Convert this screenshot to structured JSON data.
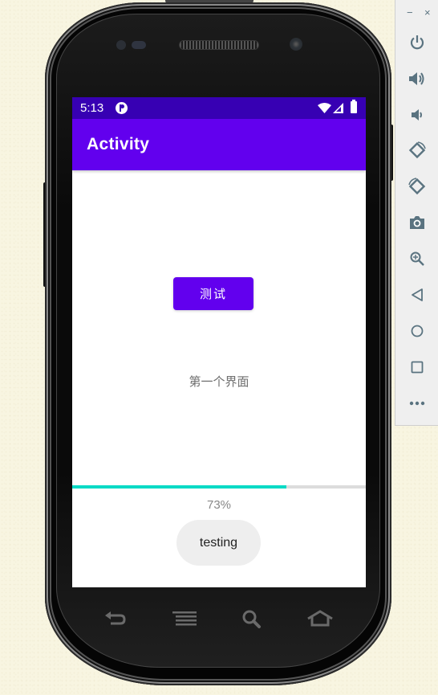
{
  "status_bar": {
    "time": "5:13",
    "app_icon": "notification-app-icon",
    "icons": [
      "wifi-icon",
      "signal-icon",
      "battery-icon"
    ]
  },
  "app_bar": {
    "title": "Activity"
  },
  "main": {
    "test_button_label": "测试",
    "page_label": "第一个界面",
    "progress": {
      "percent": 73,
      "text": "73%"
    },
    "toast_text": "testing"
  },
  "colors": {
    "status_bar": "#3700b3",
    "primary": "#6200ee",
    "progress_accent": "#03dac5",
    "progress_track": "#dcdcdc",
    "toast_bg": "#eeeeee",
    "toolbar_icon": "#5a7380"
  },
  "hardware_keys": [
    "back-icon",
    "menu-icon",
    "search-icon",
    "home-icon"
  ],
  "emulator_toolbar": {
    "window_controls": {
      "minimize": "−",
      "close": "×"
    },
    "buttons": [
      {
        "name": "power",
        "icon": "power-icon"
      },
      {
        "name": "volume-up",
        "icon": "volume-up-icon"
      },
      {
        "name": "volume-down",
        "icon": "volume-down-icon"
      },
      {
        "name": "rotate-left",
        "icon": "rotate-left-icon"
      },
      {
        "name": "rotate-right",
        "icon": "rotate-right-icon"
      },
      {
        "name": "screenshot",
        "icon": "camera-icon"
      },
      {
        "name": "zoom",
        "icon": "zoom-in-icon"
      },
      {
        "name": "back",
        "icon": "back-triangle-icon"
      },
      {
        "name": "home",
        "icon": "home-circle-icon"
      },
      {
        "name": "overview",
        "icon": "overview-square-icon"
      },
      {
        "name": "more",
        "icon": "more-icon",
        "label": "•••"
      }
    ]
  }
}
